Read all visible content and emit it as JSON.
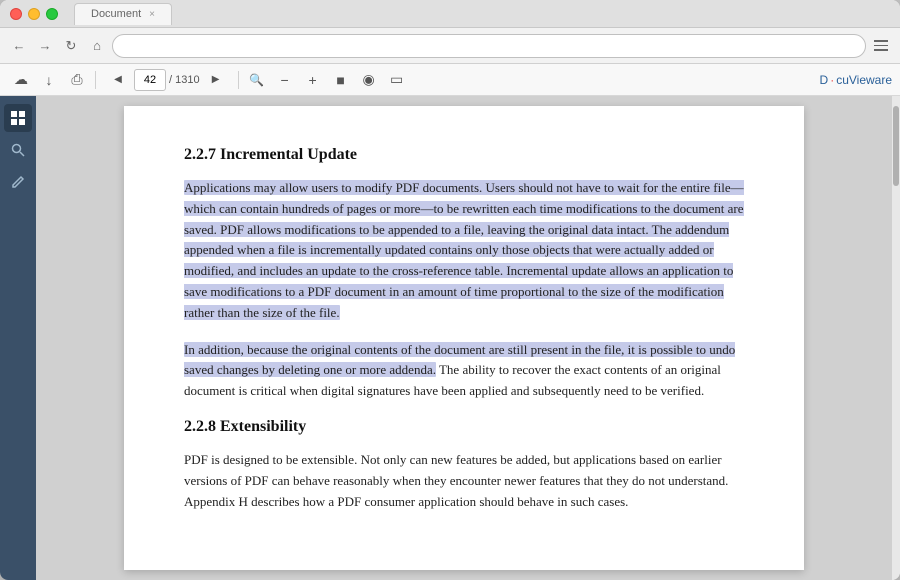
{
  "window": {
    "traffic_lights": [
      "red",
      "yellow",
      "green"
    ],
    "tab_label": "",
    "tab_close": "×"
  },
  "nav": {
    "back_icon": "←",
    "forward_icon": "→",
    "refresh_icon": "↻",
    "home_icon": "⌂",
    "address_placeholder": "",
    "menu_icon": "☰"
  },
  "toolbar": {
    "icons": [
      "☁",
      "⬇",
      "🖨",
      "⚙"
    ],
    "page_current": "42",
    "page_total": "1310",
    "nav_prev": "◀",
    "nav_next": "▶",
    "search_icon": "🔍",
    "zoom_out": "−",
    "zoom_in": "+",
    "fit_icon": "⊞",
    "view_icon": "◉",
    "select_icon": "▭",
    "logo": "D·cuVieware"
  },
  "sidebar": {
    "icons": [
      "⊞",
      "🔍",
      "✎"
    ]
  },
  "content": {
    "section_227": {
      "heading": "2.2.7   Incremental Update",
      "paragraph1": "Applications may allow users to modify PDF documents. Users should not have to wait for the entire file—which can contain hundreds of pages or more—to be rewritten each time modifications to the document are saved. PDF allows modifications to be appended to a file, leaving the original data intact. The addendum appended when a file is incrementally updated contains only those objects that were actually added or modified, and includes an update to the cross-reference table. Incremental update allows an application to save modifications to a PDF document in an amount of time proportional to the size of the modification rather than the size of the file.",
      "paragraph1_highlight_start": 0,
      "paragraph1_highlight_end": 2,
      "paragraph2": "In addition, because the original contents of the document are still present in the file, it is possible to undo saved changes by deleting one or more addenda. The ability to recover the exact contents of an original document is critical when digital signatures have been applied and subsequently need to be verified.",
      "paragraph2_highlight_end": 1
    },
    "section_228": {
      "heading": "2.2.8   Extensibility",
      "paragraph": "PDF is designed to be extensible. Not only can new features be added, but applications based on earlier versions of PDF can behave reasonably when they encounter newer features that they do not understand. Appendix H describes how a PDF consumer application should behave in such cases."
    }
  }
}
